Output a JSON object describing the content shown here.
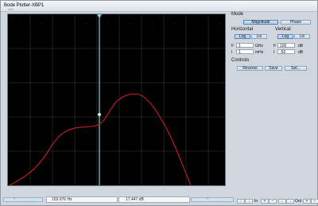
{
  "window": {
    "title": "Bode Plotter-XBP1",
    "subtitle": "XBP1"
  },
  "plot": {
    "background": "#000000",
    "grid_color": "#2a2a2a",
    "curve_color": "#b51d24",
    "cursor_color": "#7fd3d6",
    "chart_data": {
      "type": "line",
      "series": [
        {
          "values": [
            [
              0.0,
              216.0
            ],
            [
              0.05,
              208.0
            ],
            [
              0.1,
              198.0
            ],
            [
              0.15,
              178.0
            ],
            [
              0.2,
              159.0
            ],
            [
              0.25,
              148.0
            ],
            [
              0.3,
              142.0
            ],
            [
              0.35,
              141.0
            ],
            [
              0.4,
              140.0
            ],
            [
              0.44,
              136.0
            ],
            [
              0.48,
              126.0
            ],
            [
              0.52,
              113.0
            ],
            [
              0.56,
              104.0
            ],
            [
              0.6,
              100.0
            ],
            [
              0.64,
              104.0
            ],
            [
              0.68,
              116.0
            ],
            [
              0.72,
              132.0
            ],
            [
              0.76,
              153.0
            ],
            [
              0.8,
              179.0
            ],
            [
              0.84,
              205.0
            ],
            [
              0.88,
              225.0
            ],
            [
              0.92,
              242.0
            ]
          ]
        }
      ],
      "x_log_scale": true,
      "grid": true
    }
  },
  "status": {
    "left_arrow": "←",
    "right_arrow": "→",
    "frequency_readout": "103.076 Hz",
    "gain_readout": "17.447 dB"
  },
  "panel": {
    "mode_label": "Mode",
    "magnitude": "Magnitude",
    "phase": "Phase",
    "horizontal_label": "Horizontal",
    "vertical_label": "Vertical",
    "log": "Log",
    "lin": "Lin",
    "h_f_label": "F",
    "h_f_value": "1",
    "h_f_unit": "GHz",
    "h_i_label": "I",
    "h_i_value": "1",
    "h_i_unit": "mHz",
    "v_f_label": "F",
    "v_f_value": "100",
    "v_f_unit": "dB",
    "v_i_label": "I",
    "v_i_value": "-50",
    "v_i_unit": "dB",
    "controls_label": "Controls",
    "reverse": "Reverse",
    "save": "Save",
    "set": "Set..."
  },
  "bottom": {
    "left_arrow": "←",
    "right_arrow": "→",
    "in_label": "In",
    "out_label": "Out",
    "plus": "+",
    "minus": "−"
  }
}
